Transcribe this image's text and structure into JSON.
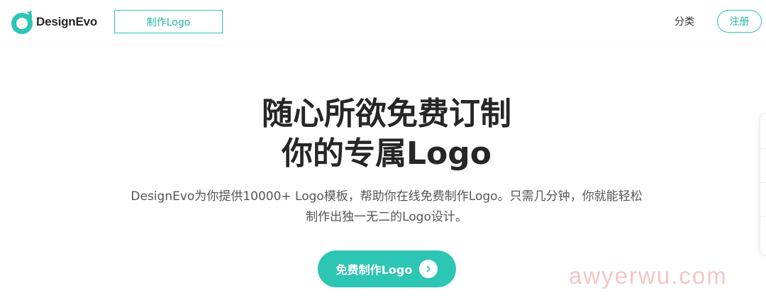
{
  "header": {
    "logo_text": "DesignEvo",
    "make_logo_label": "制作Logo",
    "category_label": "分类",
    "register_label": "注册"
  },
  "hero": {
    "title_line1": "随心所欲免费订制",
    "title_line2": "你的专属Logo",
    "subtitle_line1": "DesignEvo为你提供10000+ Logo模板，帮助你在线免费制作Logo。只需几分钟，你就能轻松",
    "subtitle_line2": "制作出独一无二的Logo设计。",
    "cta_label": "免费制作Logo"
  },
  "watermark": "awyerwu.com",
  "icons": {
    "logo": "designevo-logo-icon",
    "cta_arrow": "chevron-right-icon"
  },
  "colors": {
    "accent": "#2dc5b4",
    "accent_text": "#23b7a6",
    "title": "#262626",
    "subtitle": "#555555",
    "watermark": "#ec9696"
  }
}
